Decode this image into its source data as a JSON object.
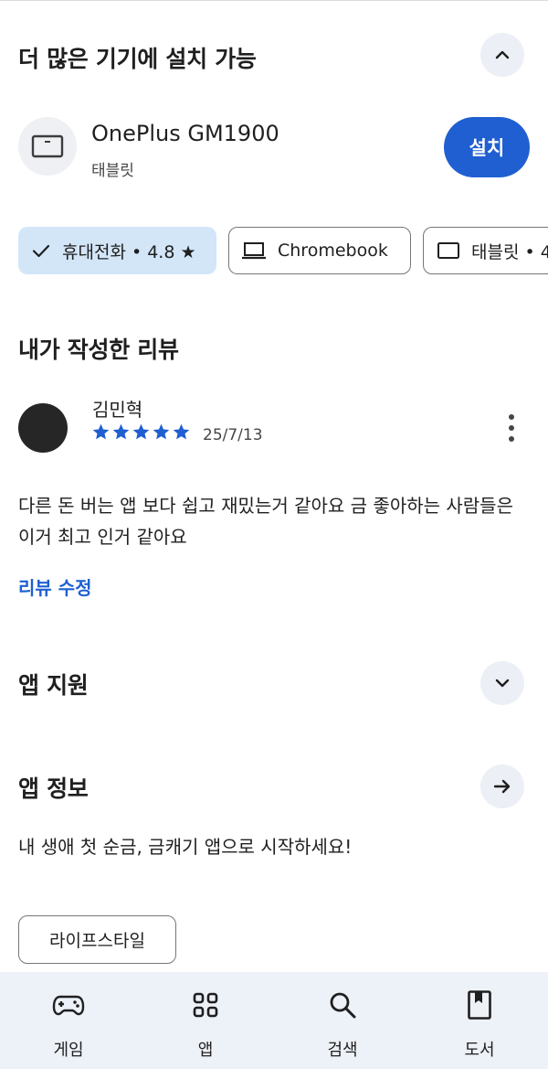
{
  "install_section": {
    "title": "더 많은 기기에 설치 가능",
    "device_name": "OnePlus GM1900",
    "device_type": "태블릿",
    "install_label": "설치"
  },
  "device_chips": [
    {
      "label": "휴대전화 • 4.8 ★",
      "icon": "check-icon",
      "selected": true
    },
    {
      "label": "Chromebook",
      "icon": "laptop-icon",
      "selected": false
    },
    {
      "label": "태블릿 • 4",
      "icon": "tablet-icon",
      "selected": false
    }
  ],
  "my_review": {
    "title": "내가 작성한 리뷰",
    "reviewer": "김민혁",
    "rating": 5,
    "date": "25/7/13",
    "text": "다른 돈 버는 앱 보다 쉽고 재밌는거 같아요 금 좋아하는 사람들은 이거 최고 인거 같아요",
    "edit_label": "리뷰 수정"
  },
  "app_support": {
    "title": "앱 지원"
  },
  "app_info": {
    "title": "앱 정보",
    "description": "내 생애 첫 순금, 금캐기 앱으로 시작하세요!",
    "category": "라이프스타일"
  },
  "bottom_nav": [
    {
      "label": "게임",
      "icon": "gamepad-icon"
    },
    {
      "label": "앱",
      "icon": "apps-grid-icon"
    },
    {
      "label": "검색",
      "icon": "search-icon"
    },
    {
      "label": "도서",
      "icon": "book-icon"
    }
  ],
  "colors": {
    "accent": "#1f5fd1",
    "chip_selected_bg": "#d3e6f8",
    "nav_bg": "#edf1f8",
    "round_button_bg": "#eceff5"
  }
}
